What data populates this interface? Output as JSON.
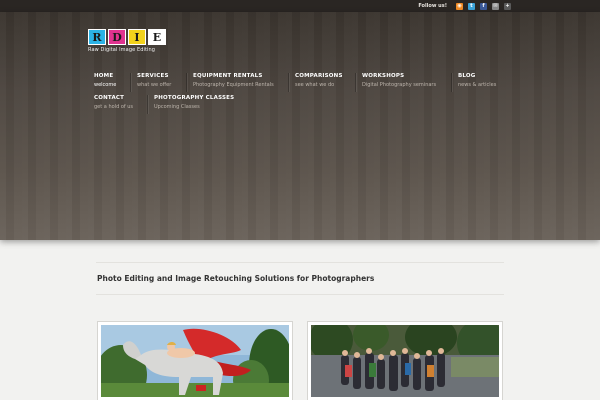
{
  "topbar": {
    "follow_label": "Follow us!",
    "icons": [
      {
        "name": "rss-icon",
        "glyph": "◉",
        "color": "#f08a24"
      },
      {
        "name": "twitter-icon",
        "glyph": "t",
        "color": "#3ba3d8"
      },
      {
        "name": "facebook-icon",
        "glyph": "f",
        "color": "#3b5998"
      },
      {
        "name": "email-icon",
        "glyph": "✉",
        "color": "#8a8a8a"
      },
      {
        "name": "plus-icon",
        "glyph": "+",
        "color": "#5a5a5a"
      }
    ]
  },
  "logo": {
    "letters": [
      "R",
      "D",
      "I",
      "E"
    ],
    "colors": [
      "#2bb3e6",
      "#e0338f",
      "#f2d21b",
      "#ffffff"
    ],
    "tagline": "Raw Digital Image Editing"
  },
  "nav": {
    "items": [
      {
        "title": "HOME",
        "sub": "welcome"
      },
      {
        "title": "SERVICES",
        "sub": "what we offer"
      },
      {
        "title": "EQUIPMENT RENTALS",
        "sub": "Photography Equipment Rentals"
      },
      {
        "title": "COMPARISONS",
        "sub": "see what we do"
      },
      {
        "title": "WORKSHOPS",
        "sub": "Digital Photography seminars"
      },
      {
        "title": "BLOG",
        "sub": "news & articles"
      },
      {
        "title": "CONTACT",
        "sub": "get a hold of us"
      },
      {
        "title": "PHOTOGRAPHY CLASSES",
        "sub": "Upcoming Classes"
      }
    ]
  },
  "main": {
    "tagline": "Photo Editing and Image Retouching Solutions for Photographers"
  }
}
